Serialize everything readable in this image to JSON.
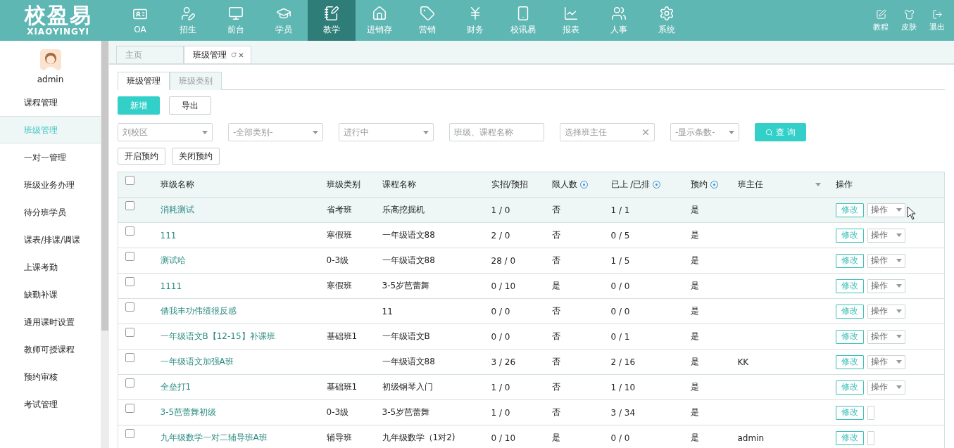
{
  "logo": {
    "title": "校盈易",
    "subtitle": "XIAOYINGYI"
  },
  "nav": [
    {
      "label": "OA",
      "selected": false
    },
    {
      "label": "招生",
      "selected": false
    },
    {
      "label": "前台",
      "selected": false
    },
    {
      "label": "学员",
      "selected": false
    },
    {
      "label": "教学",
      "selected": true
    },
    {
      "label": "进销存",
      "selected": false
    },
    {
      "label": "营销",
      "selected": false
    },
    {
      "label": "财务",
      "selected": false
    },
    {
      "label": "校讯易",
      "selected": false
    },
    {
      "label": "报表",
      "selected": false
    },
    {
      "label": "人事",
      "selected": false
    },
    {
      "label": "系统",
      "selected": false
    }
  ],
  "top_actions": [
    "教程",
    "皮肤",
    "退出"
  ],
  "user": {
    "name": "admin"
  },
  "sidebar": {
    "items": [
      {
        "label": "课程管理",
        "selected": false
      },
      {
        "label": "班级管理",
        "selected": true
      },
      {
        "label": "一对一管理",
        "selected": false
      },
      {
        "label": "班级业务办理",
        "selected": false
      },
      {
        "label": "待分班学员",
        "selected": false
      },
      {
        "label": "课表/排课/调课",
        "selected": false
      },
      {
        "label": "上课考勤",
        "selected": false
      },
      {
        "label": "缺勤补课",
        "selected": false
      },
      {
        "label": "通用课时设置",
        "selected": false
      },
      {
        "label": "教师可授课程",
        "selected": false
      },
      {
        "label": "预约审核",
        "selected": false
      },
      {
        "label": "考试管理",
        "selected": false
      }
    ]
  },
  "page_tabs": [
    {
      "label": "主页",
      "selected": false,
      "closable": false
    },
    {
      "label": "班级管理",
      "selected": true,
      "closable": true
    }
  ],
  "sub_tabs": [
    {
      "label": "班级管理",
      "selected": true
    },
    {
      "label": "班级类别",
      "selected": false
    }
  ],
  "toolbar": [
    {
      "label": "新增",
      "kind": "primary"
    },
    {
      "label": "导出",
      "kind": "default"
    }
  ],
  "filters": [
    {
      "kind": "select",
      "value": "刘校区"
    },
    {
      "kind": "select",
      "placeholder": "-全部类别-"
    },
    {
      "kind": "select",
      "value": "进行中"
    },
    {
      "kind": "input",
      "placeholder": "班级、课程名称"
    },
    {
      "kind": "clearable",
      "placeholder": "选择班主任"
    },
    {
      "kind": "select",
      "placeholder": "-显示条数-"
    }
  ],
  "search_button": "查 询",
  "booking_buttons": [
    "开启预约",
    "关闭预约"
  ],
  "table": {
    "select_all_checked": false,
    "columns": [
      {
        "label": "班级名称",
        "help": false,
        "sortable": false
      },
      {
        "label": "班级类别",
        "help": false,
        "sortable": false
      },
      {
        "label": "课程名称",
        "help": false,
        "sortable": false
      },
      {
        "label": "实招/预招",
        "help": false,
        "sortable": false
      },
      {
        "label": "限人数",
        "help": true,
        "sortable": false
      },
      {
        "label": "已上 /已排",
        "help": true,
        "sortable": false
      },
      {
        "label": "预约",
        "help": true,
        "sortable": false
      },
      {
        "label": "班主任",
        "help": false,
        "sortable": true
      },
      {
        "label": "操作",
        "help": false,
        "sortable": false
      }
    ],
    "rows": [
      {
        "checked": false,
        "hovered": true,
        "cells": [
          "消耗测试",
          "省考班",
          "乐高挖掘机",
          "1 / 0",
          "否",
          "1 / 1",
          "是",
          ""
        ],
        "edit": "修改",
        "menu": "操作"
      },
      {
        "checked": false,
        "hovered": false,
        "cells": [
          "111",
          "寒假班",
          "一年级语文88",
          "2 / 0",
          "否",
          "0 / 5",
          "是",
          ""
        ],
        "edit": "修改",
        "menu": "操作"
      },
      {
        "checked": false,
        "hovered": false,
        "cells": [
          "测试哈",
          "0-3级",
          "一年级语文88",
          "28 / 0",
          "否",
          "1 / 5",
          "是",
          ""
        ],
        "edit": "修改",
        "menu": "操作"
      },
      {
        "checked": false,
        "hovered": false,
        "cells": [
          "1111",
          "寒假班",
          "3-5岁芭蕾舞",
          "0 / 10",
          "是",
          "0 / 0",
          "是",
          ""
        ],
        "edit": "修改",
        "menu": "操作"
      },
      {
        "checked": false,
        "hovered": false,
        "cells": [
          "借我丰功伟绩很反感",
          "",
          "11",
          "0 / 0",
          "否",
          "0 / 0",
          "是",
          ""
        ],
        "edit": "修改",
        "menu": "操作"
      },
      {
        "checked": false,
        "hovered": false,
        "cells": [
          "一年级语文B【12-15】补课班",
          "基础班1",
          "一年级语文B",
          "0 / 0",
          "否",
          "0 / 1",
          "是",
          ""
        ],
        "edit": "修改",
        "menu": "操作"
      },
      {
        "checked": false,
        "hovered": false,
        "cells": [
          "一年级语文加强A班",
          "",
          "一年级语文88",
          "3 / 26",
          "否",
          "2 / 16",
          "是",
          "KK"
        ],
        "edit": "修改",
        "menu": "操作"
      },
      {
        "checked": false,
        "hovered": false,
        "cells": [
          "全垒打1",
          "基础班1",
          "初级钢琴入门",
          "1 / 0",
          "否",
          "1 / 10",
          "是",
          ""
        ],
        "edit": "修改",
        "menu": "操作"
      },
      {
        "checked": false,
        "hovered": false,
        "cells": [
          "3-5芭蕾舞初级",
          "0-3级",
          "3-5岁芭蕾舞",
          "1 / 0",
          "否",
          "3 / 34",
          "是",
          ""
        ],
        "edit": "修改"
      },
      {
        "checked": false,
        "hovered": false,
        "cells": [
          "九年级数学一对二辅导班A班",
          "辅导班",
          "九年级数学（1对2)",
          "0 / 10",
          "是",
          "0 / 0",
          "是",
          "admin"
        ],
        "edit": "修改"
      }
    ]
  }
}
